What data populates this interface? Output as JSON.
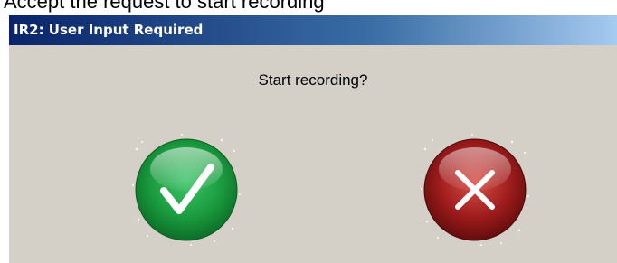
{
  "caption": "Accept the request to start recording",
  "dialog": {
    "title": "IR2: User Input Required",
    "prompt": "Start recording?",
    "buttons": {
      "accept_icon": "checkmark-icon",
      "accept_color": "#1a9a3e",
      "cancel_icon": "x-icon",
      "cancel_color": "#9c1b1b"
    }
  }
}
